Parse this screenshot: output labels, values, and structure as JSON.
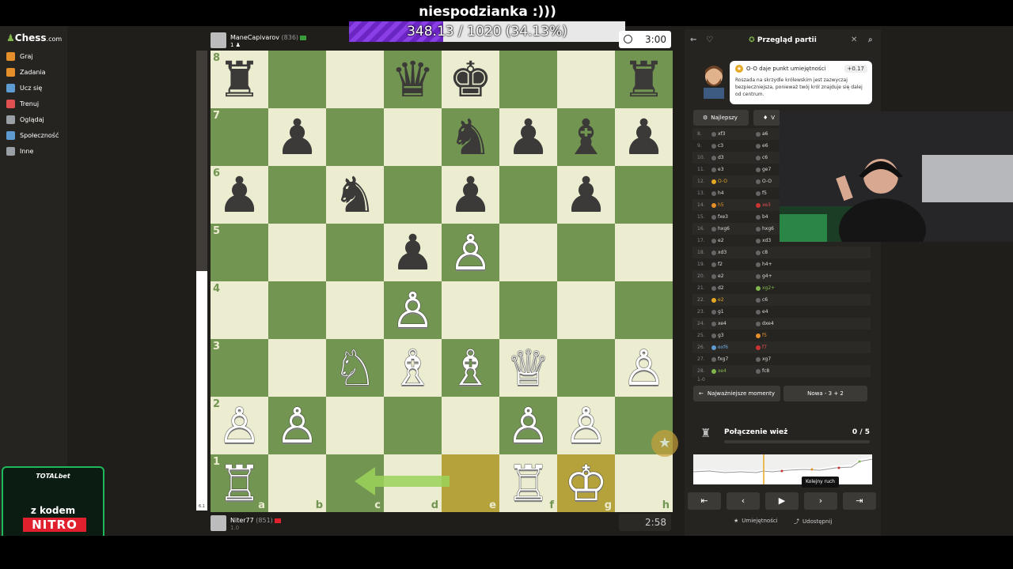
{
  "stream": {
    "title": "niespodzianka :)))",
    "sub_goal": {
      "text": "348.13 / 1020 (34.13%)",
      "progress": 0.3413
    }
  },
  "sidebar": {
    "logo": "Chess",
    "logo_suffix": ".com",
    "items": [
      {
        "label": "Graj",
        "icon": "pawn-icon",
        "color": "#e58f2a"
      },
      {
        "label": "Zadania",
        "icon": "puzzle-icon",
        "color": "#e58f2a"
      },
      {
        "label": "Ucz się",
        "icon": "learn-icon",
        "color": "#5d9bd0"
      },
      {
        "label": "Trenuj",
        "icon": "train-icon",
        "color": "#e05050"
      },
      {
        "label": "Oglądaj",
        "icon": "watch-icon",
        "color": "#9aa0a6"
      },
      {
        "label": "Społeczność",
        "icon": "community-icon",
        "color": "#5d9bd0"
      },
      {
        "label": "Inne",
        "icon": "more-icon",
        "color": "#9aa0a6"
      }
    ]
  },
  "top_player": {
    "name": "ManeCapivarov",
    "rating": "(836)",
    "sub": "1 ♟",
    "clock": "3:00",
    "flag_color": "#3b9b3a"
  },
  "bottom_player": {
    "name": "Niter77",
    "rating": "(851)",
    "sub": "1.0",
    "clock": "2:58",
    "flag_color": "#e0202c"
  },
  "board": {
    "files": [
      "a",
      "b",
      "c",
      "d",
      "e",
      "f",
      "g",
      "h"
    ],
    "ranks": [
      "8",
      "7",
      "6",
      "5",
      "4",
      "3",
      "2",
      "1"
    ],
    "pieces": [
      {
        "sq": "a8",
        "p": "♜",
        "c": "b"
      },
      {
        "sq": "d8",
        "p": "♛",
        "c": "b"
      },
      {
        "sq": "e8",
        "p": "♚",
        "c": "b"
      },
      {
        "sq": "h8",
        "p": "♜",
        "c": "b"
      },
      {
        "sq": "b7",
        "p": "♟",
        "c": "b"
      },
      {
        "sq": "e7",
        "p": "♞",
        "c": "b"
      },
      {
        "sq": "f7",
        "p": "♟",
        "c": "b"
      },
      {
        "sq": "g7",
        "p": "♝",
        "c": "b"
      },
      {
        "sq": "h7",
        "p": "♟",
        "c": "b"
      },
      {
        "sq": "a6",
        "p": "♟",
        "c": "b"
      },
      {
        "sq": "c6",
        "p": "♞",
        "c": "b"
      },
      {
        "sq": "e6",
        "p": "♟",
        "c": "b"
      },
      {
        "sq": "g6",
        "p": "♟",
        "c": "b"
      },
      {
        "sq": "d5",
        "p": "♟",
        "c": "b"
      },
      {
        "sq": "e5",
        "p": "♙",
        "c": "w"
      },
      {
        "sq": "d4",
        "p": "♙",
        "c": "w"
      },
      {
        "sq": "c3",
        "p": "♘",
        "c": "w"
      },
      {
        "sq": "d3",
        "p": "♗",
        "c": "w"
      },
      {
        "sq": "e3",
        "p": "♗",
        "c": "w"
      },
      {
        "sq": "f3",
        "p": "♕",
        "c": "w"
      },
      {
        "sq": "h3",
        "p": "♙",
        "c": "w"
      },
      {
        "sq": "a2",
        "p": "♙",
        "c": "w"
      },
      {
        "sq": "b2",
        "p": "♙",
        "c": "w"
      },
      {
        "sq": "f2",
        "p": "♙",
        "c": "w"
      },
      {
        "sq": "g2",
        "p": "♙",
        "c": "w"
      },
      {
        "sq": "a1",
        "p": "♖",
        "c": "w"
      },
      {
        "sq": "f1",
        "p": "♖",
        "c": "w"
      },
      {
        "sq": "g1",
        "p": "♔",
        "c": "w"
      }
    ],
    "highlights": [
      "e1",
      "g1"
    ],
    "arrow": {
      "from": "e1",
      "to": "c1"
    },
    "eval_white_fraction": 0.52,
    "eval_label": "6.1"
  },
  "review": {
    "title": "Przegląd partii",
    "coach": {
      "headline": "O-O daje punkt umiejętności",
      "score": "+0.17",
      "text": "Roszada na skrzydle królewskim jest zazwyczaj bezpieczniejsza, ponieważ twój król znajduje się dalej od centrum."
    },
    "tabs": [
      {
        "label": "Najlepszy"
      },
      {
        "label": "V"
      }
    ],
    "moves": [
      {
        "n": "8.",
        "w": "xf3",
        "b": "a6"
      },
      {
        "n": "9.",
        "w": "c3",
        "b": "e6"
      },
      {
        "n": "10.",
        "w": "d3",
        "b": "c6"
      },
      {
        "n": "11.",
        "w": "e3",
        "b": "ge7"
      },
      {
        "n": "12.",
        "w": "O-O",
        "b": "O-O",
        "wk": "best"
      },
      {
        "n": "13.",
        "w": "h4",
        "b": "f5"
      },
      {
        "n": "14.",
        "w": "h5",
        "b": "xe3",
        "wk": "mistake",
        "bk": "blunder"
      },
      {
        "n": "15.",
        "w": "fxe3",
        "b": "b4"
      },
      {
        "n": "16.",
        "w": "hxg6",
        "b": "hxg6"
      },
      {
        "n": "17.",
        "w": "e2",
        "b": "xd3"
      },
      {
        "n": "18.",
        "w": "xd3",
        "b": "c8"
      },
      {
        "n": "19.",
        "w": "f2",
        "b": "h4+"
      },
      {
        "n": "20.",
        "w": "e2",
        "b": "g4+"
      },
      {
        "n": "21.",
        "w": "d2",
        "b": "xg2+",
        "bk": "great"
      },
      {
        "n": "22.",
        "w": "e2",
        "b": "c6",
        "wk": "best"
      },
      {
        "n": "23.",
        "w": "g1",
        "b": "e4"
      },
      {
        "n": "24.",
        "w": "xe4",
        "b": "dxe4"
      },
      {
        "n": "25.",
        "w": "g3",
        "b": "f5",
        "bk": "mistake"
      },
      {
        "n": "26.",
        "w": "exf6",
        "b": "f7",
        "wk": "book",
        "bk": "blunder"
      },
      {
        "n": "27.",
        "w": "fxg7",
        "b": "xg7"
      },
      {
        "n": "28.",
        "w": "xe4",
        "b": "fc8",
        "wk": "great"
      }
    ],
    "result": "1-0",
    "key_moments_btn": "Najważniejsze momenty",
    "game_type_btn": "Nowa - 3 + 2",
    "connection": {
      "label": "Połączenie wież",
      "count": "0 / 5"
    },
    "tooltip": "Kolejny ruch",
    "footer": {
      "skills": "Umiejętności",
      "share": "Udostępnij"
    }
  },
  "sponsor": {
    "brand": "TOTALbet",
    "line1": "z kodem",
    "code": "NITRO"
  }
}
